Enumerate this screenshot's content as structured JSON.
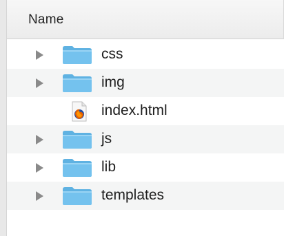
{
  "header": {
    "name_label": "Name"
  },
  "items": [
    {
      "label": "css",
      "type": "folder",
      "icon": "folder-icon"
    },
    {
      "label": "img",
      "type": "folder",
      "icon": "folder-icon"
    },
    {
      "label": "index.html",
      "type": "file",
      "icon": "firefox-html-file-icon"
    },
    {
      "label": "js",
      "type": "folder",
      "icon": "folder-icon"
    },
    {
      "label": "lib",
      "type": "folder",
      "icon": "folder-icon"
    },
    {
      "label": "templates",
      "type": "folder",
      "icon": "folder-icon"
    }
  ],
  "colors": {
    "folder_body": "#74c2ee",
    "folder_tab": "#5fb2e2",
    "disclosure": "#8a8a8a",
    "alt_row": "#f4f5f5"
  }
}
